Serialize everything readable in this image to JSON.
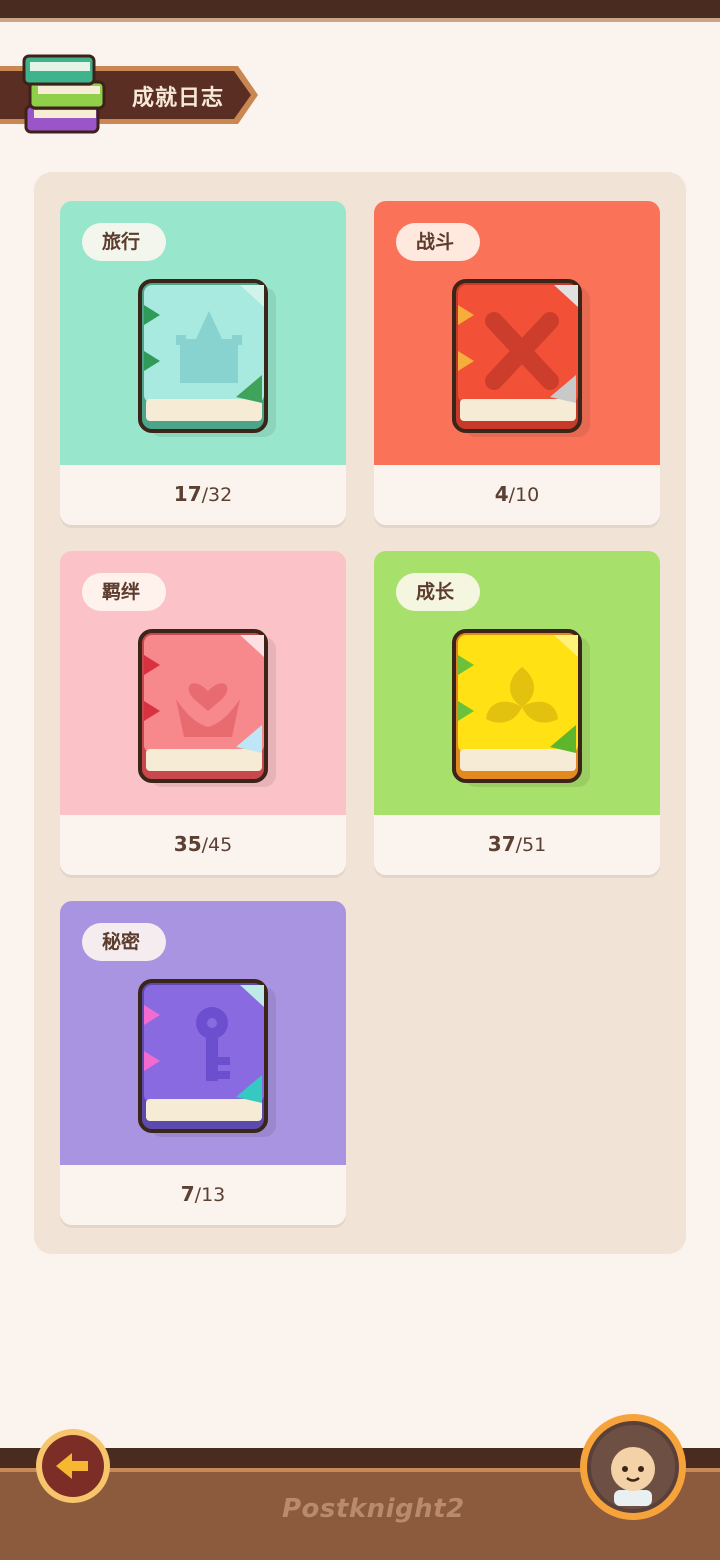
{
  "header": {
    "title": "成就日志"
  },
  "categories": [
    {
      "label": "旅行",
      "done": "17",
      "total": "32",
      "color": "#98e6cc",
      "book_icon": "castle-book-icon"
    },
    {
      "label": "战斗",
      "done": "4",
      "total": "10",
      "color": "#fa7358",
      "book_icon": "crossed-swords-book-icon"
    },
    {
      "label": "羁绊",
      "done": "35",
      "total": "45",
      "color": "#fbc3c8",
      "book_icon": "heart-hands-book-icon"
    },
    {
      "label": "成长",
      "done": "37",
      "total": "51",
      "color": "#a8e06c",
      "book_icon": "leaf-book-icon"
    },
    {
      "label": "秘密",
      "done": "7",
      "total": "13",
      "color": "#a894e0",
      "book_icon": "key-book-icon"
    }
  ],
  "footer": {
    "logo_text": "Postknight2",
    "back_icon": "back-arrow-icon",
    "avatar_icon": "avatar-icon"
  }
}
